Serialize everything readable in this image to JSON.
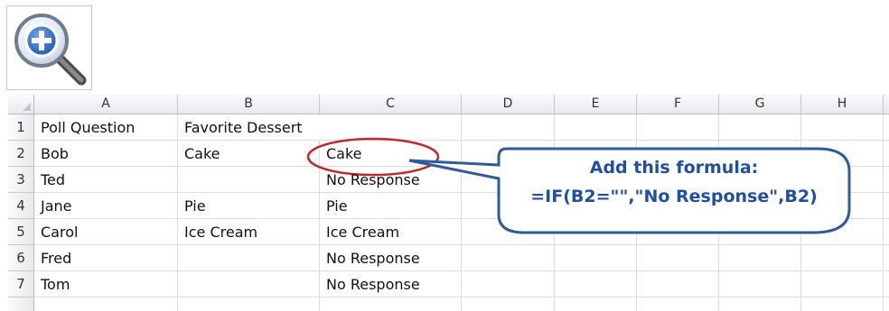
{
  "zoom": {
    "icon": "zoom-in-magnifier-icon"
  },
  "columns": [
    "A",
    "B",
    "C",
    "D",
    "E",
    "F",
    "G",
    "H"
  ],
  "rows": [
    {
      "num": "1",
      "cells": [
        "Poll Question",
        "Favorite Dessert",
        ""
      ]
    },
    {
      "num": "2",
      "cells": [
        "Bob",
        "Cake",
        "Cake"
      ]
    },
    {
      "num": "3",
      "cells": [
        "Ted",
        "",
        "No Response"
      ]
    },
    {
      "num": "4",
      "cells": [
        "Jane",
        "Pie",
        "Pie"
      ]
    },
    {
      "num": "5",
      "cells": [
        "Carol",
        "Ice Cream",
        "Ice Cream"
      ]
    },
    {
      "num": "6",
      "cells": [
        "Fred",
        "",
        "No Response"
      ]
    },
    {
      "num": "7",
      "cells": [
        "Tom",
        "",
        "No Response"
      ]
    }
  ],
  "callout": {
    "title": "Add this formula:",
    "formula": "=IF(B2=\"\",\"No Response\",B2)",
    "color": "#1f4f9e"
  },
  "highlight_color": "#c0282d"
}
